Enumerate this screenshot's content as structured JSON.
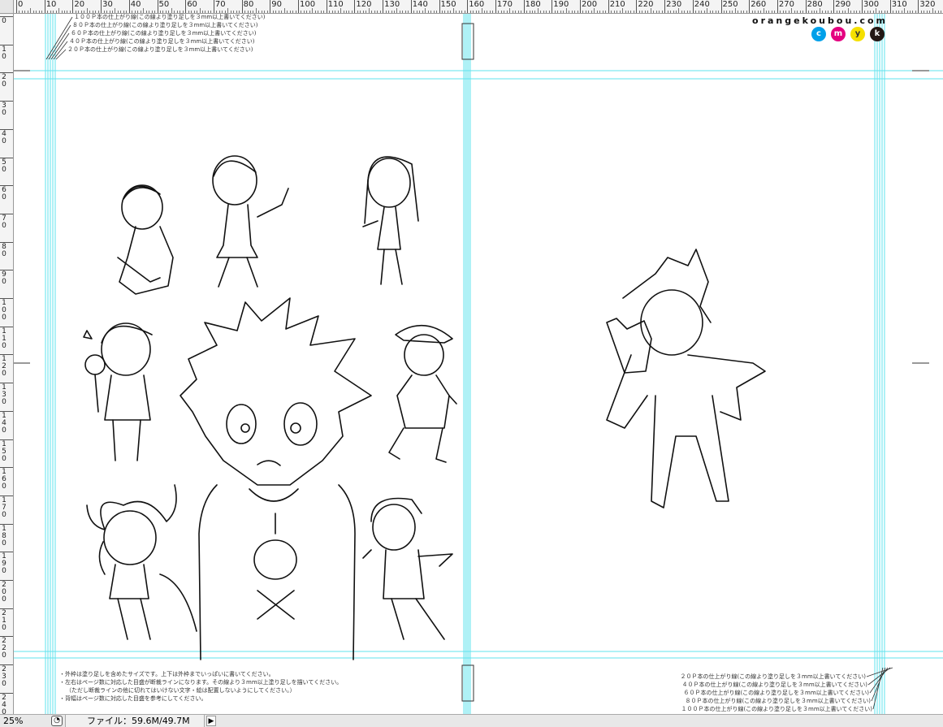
{
  "ruler": {
    "top_labels": [
      "0",
      "10",
      "20",
      "30",
      "40",
      "50",
      "60",
      "70",
      "80",
      "90",
      "100",
      "110",
      "120",
      "130",
      "140",
      "150",
      "160",
      "170",
      "180",
      "190",
      "200",
      "210",
      "220",
      "230",
      "240",
      "250",
      "260",
      "270",
      "280",
      "290",
      "300",
      "310",
      "320"
    ],
    "left_labels": [
      "0",
      "10",
      "20",
      "30",
      "40",
      "50",
      "60",
      "70",
      "80",
      "90",
      "100",
      "110",
      "120",
      "130",
      "140",
      "150",
      "160",
      "170",
      "180",
      "190",
      "200",
      "210",
      "220",
      "230",
      "240"
    ]
  },
  "trim_notes_top": [
    "１００Ｐ本の仕上がり線(この線より塗り足しを３mm以上書いてください)",
    "８０Ｐ本の仕上がり線(この線より塗り足しを３mm以上書いてください)",
    "６０Ｐ本の仕上がり線(この線より塗り足しを３mm以上書いてください)",
    "４０Ｐ本の仕上がり線(この線より塗り足しを３mm以上書いてください)",
    "２０Ｐ本の仕上がり線(この線より塗り足しを３mm以上書いてください)"
  ],
  "trim_notes_bottom": [
    "２０Ｐ本の仕上がり線(この線より塗り足しを３mm以上書いてください)",
    "４０Ｐ本の仕上がり線(この線より塗り足しを３mm以上書いてください)",
    "６０Ｐ本の仕上がり線(この線より塗り足しを３mm以上書いてください)",
    "８０Ｐ本の仕上がり線(この線より塗り足しを３mm以上書いてください)",
    "１００Ｐ本の仕上がり線(この線より塗り足しを３mm以上書いてください)"
  ],
  "brand": {
    "name": "orangekoubou.com",
    "cmyk": [
      {
        "letter": "c",
        "color": "#00a0e9"
      },
      {
        "letter": "m",
        "color": "#e4007f"
      },
      {
        "letter": "y",
        "color": "#f5e000"
      },
      {
        "letter": "k",
        "color": "#231815"
      }
    ]
  },
  "bottom_notes": [
    "・外枠は塗り足しを含めたサイズです。上下は外枠までいっぱいに書いてください。",
    "・左右はページ数に対応した目盛が断裁ラインになります。その線より３mm以上塗り足しを描いてください。",
    "（ただし断裁ラインの他に切れてはいけない文字・絵は配置しないようにしてください。）",
    "・背幅はページ数に対応した目盛を参考にしてください。"
  ],
  "guide_color": "#5fe3ee",
  "status": {
    "zoom": "25%",
    "file_info": "ファイル：59.6M/49.7M",
    "doc_icon": "document-status-icon",
    "arrow_icon": "triangle-right-icon"
  }
}
